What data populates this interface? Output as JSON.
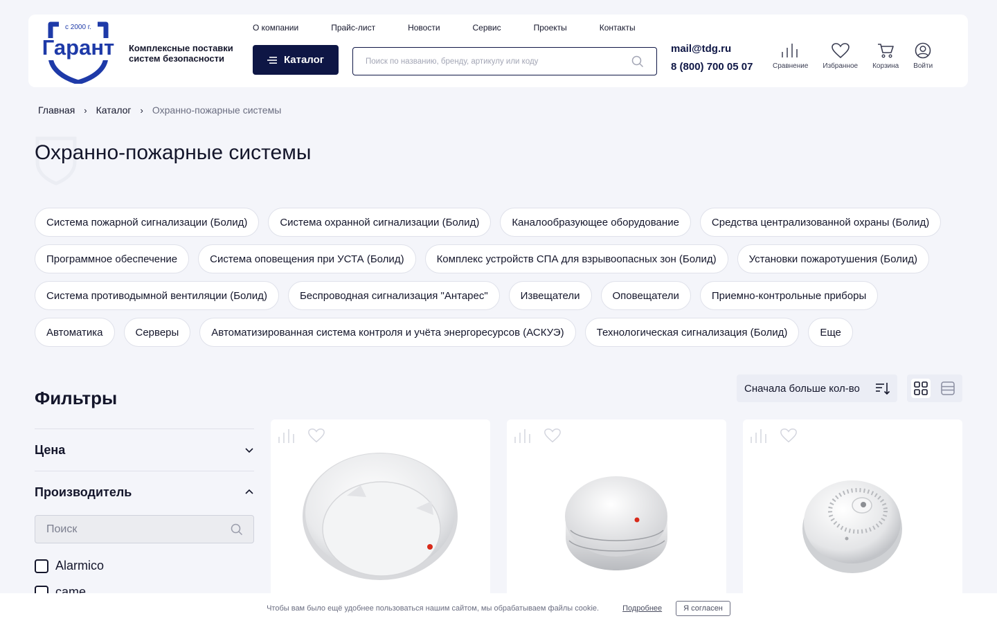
{
  "header": {
    "logo": {
      "badge": "с 2000 г.",
      "name": "Гарант"
    },
    "tagline": "Комплексные поставки систем безопасности",
    "nav": [
      "О компании",
      "Прайс-лист",
      "Новости",
      "Сервис",
      "Проекты",
      "Контакты"
    ],
    "catalog_label": "Каталог",
    "search_placeholder": "Поиск по названию, бренду, артикулу или коду",
    "email": "mail@tdg.ru",
    "phone": "8 (800) 700 05 07",
    "actions": {
      "compare": "Сравнение",
      "favorites": "Избранное",
      "cart": "Корзина",
      "login": "Войти"
    }
  },
  "breadcrumb": [
    "Главная",
    "Каталог",
    "Охранно-пожарные системы"
  ],
  "page_title": "Охранно-пожарные системы",
  "categories": [
    "Система пожарной сигнализации (Болид)",
    "Система охранной сигнализации (Болид)",
    "Каналообразующее оборудование",
    "Средства централизованной охраны (Болид)",
    "Программное обеспечение",
    "Система оповещения при УСТА (Болид)",
    "Комплекс устройств СПА для взрывоопасных зон (Болид)",
    "Установки пожаротушения (Болид)",
    "Система противодымной вентиляции (Болид)",
    "Беспроводная сигнализация \"Антарес\"",
    "Извещатели",
    "Оповещатели",
    "Приемно-контрольные приборы",
    "Автоматика",
    "Серверы",
    "Автоматизированная система контроля и учёта энергоресурсов (АСКУЭ)",
    "Технологическая сигнализация (Болид)",
    "Еще"
  ],
  "sort": {
    "selected": "Сначала больше кол-во"
  },
  "filters": {
    "title": "Фильтры",
    "price_label": "Цена",
    "manufacturer_label": "Производитель",
    "manufacturer_search_placeholder": "Поиск",
    "manufacturers": [
      "Alarmico",
      "came"
    ]
  },
  "cookie": {
    "text": "Чтобы вам было ещё удобнее пользоваться нашим сайтом, мы обрабатываем файлы cookie.",
    "more": "Подробнее",
    "accept": "Я согласен"
  },
  "colors": {
    "brand": "#1e3aa8",
    "dark": "#0e1645",
    "background": "#f4f5fa"
  }
}
